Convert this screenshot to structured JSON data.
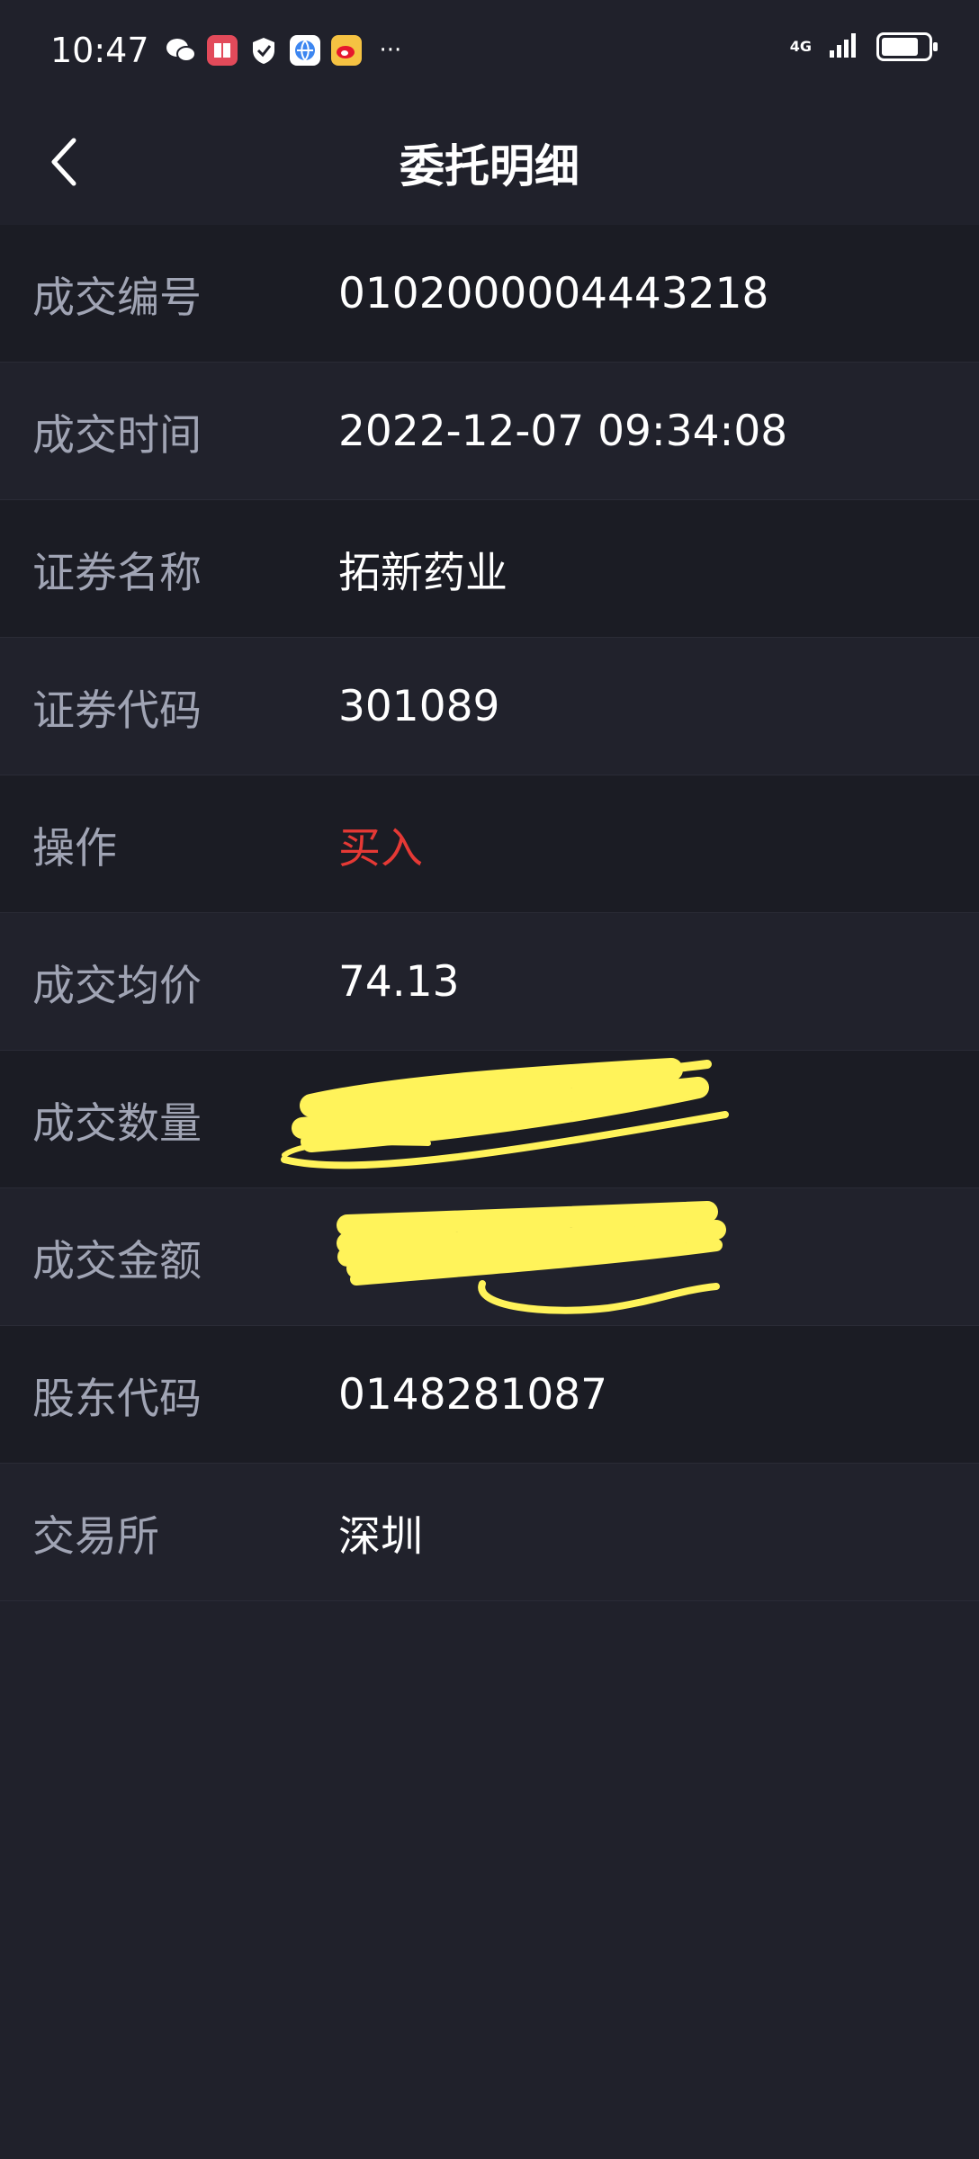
{
  "status_bar": {
    "time": "10:47",
    "more": "···",
    "network": "4G",
    "battery_level": 0.8,
    "notifications": [
      "wechat-icon",
      "reader-icon",
      "shield-icon",
      "browser-icon",
      "weibo-icon"
    ]
  },
  "header": {
    "title": "委托明细"
  },
  "rows": [
    {
      "label": "成交编号",
      "value": "0102000004443218"
    },
    {
      "label": "成交时间",
      "value": "2022-12-07 09:34:08"
    },
    {
      "label": "证券名称",
      "value": "拓新药业"
    },
    {
      "label": "证券代码",
      "value": "301089"
    },
    {
      "label": "操作",
      "value": "买入"
    },
    {
      "label": "成交均价",
      "value": "74.13"
    },
    {
      "label": "成交数量",
      "value": ""
    },
    {
      "label": "成交金额",
      "value": ""
    },
    {
      "label": "股东代码",
      "value": "0148281087"
    },
    {
      "label": "交易所",
      "value": "深圳"
    }
  ],
  "colors": {
    "background": "#20212b",
    "row_dark": "#1b1c24",
    "label": "#a0a4b4",
    "buy_red": "#e53935",
    "redaction": "#fff35a"
  }
}
